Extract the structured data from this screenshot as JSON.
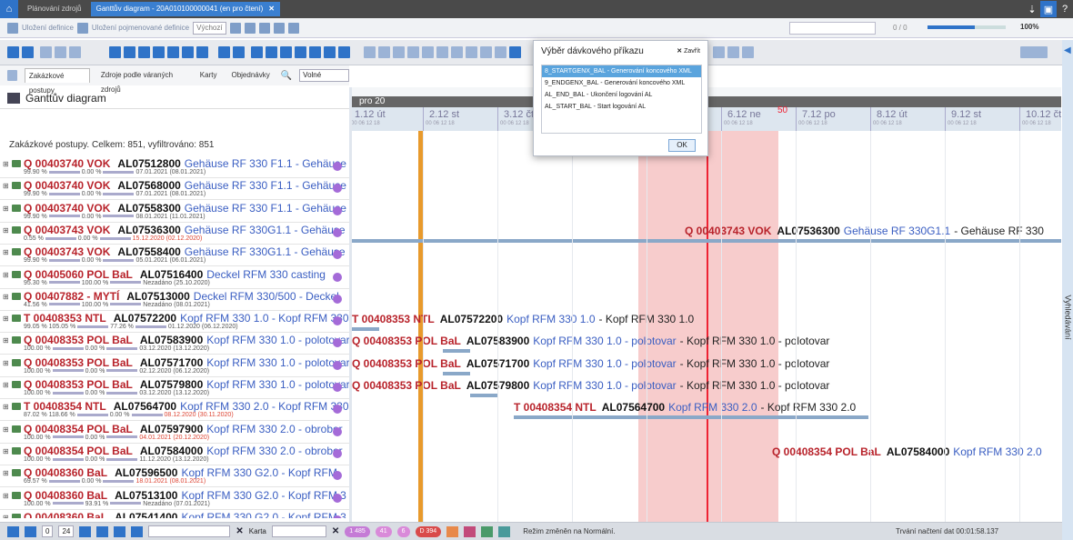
{
  "titlebar": {
    "tabs": [
      {
        "label": "Plánování zdrojů"
      },
      {
        "label": "Ganttův diagram - 20A010100000041 (en pro čtení)",
        "close": "✕"
      }
    ],
    "right_glyph_1": "⇣",
    "right_glyph_2": "?"
  },
  "toolbar2": {
    "save_label": "Uložení definice",
    "save_named_label": "Uložení pojmenované definice",
    "select_value": "Výchozí",
    "search_placeholder": "",
    "nav_text": "0 / 0",
    "zoom_label": "100%",
    "zoom_level": 0.6
  },
  "sidebar": {
    "tabs": [
      "Zakázkové postupy",
      "Zdroje podle váraných zdrojů",
      "Karty",
      "Objednávky"
    ],
    "filter_value": "Volné"
  },
  "gantt": {
    "title": "Ganttův diagram",
    "summary": "Zakázkové postupy. Celkem: 851, vyfiltrováno: 851",
    "week": "pro 20",
    "week_marker": "50",
    "days": [
      {
        "label": "1.12 út"
      },
      {
        "label": "2.12 st"
      },
      {
        "label": "3.12 čt"
      },
      {
        "label": "4.12 pá"
      },
      {
        "label": "5.12 so"
      },
      {
        "label": "6.12 ne"
      },
      {
        "label": "7.12 po"
      },
      {
        "label": "8.12 út"
      },
      {
        "label": "9.12 st"
      },
      {
        "label": "10.12 čt"
      }
    ],
    "hours": "00  06  12  18"
  },
  "rows": [
    {
      "code": "Q 00403740 VOK",
      "item": "AL07512800",
      "desc": "Gehäuse RF 330 F1.1 - Gehäuse",
      "pct1": "99.90 %",
      "pct2": "0.00 %",
      "dates": "07.01.2021 (08.01.2021)",
      "red": false
    },
    {
      "code": "Q 00403740 VOK",
      "item": "AL07568000",
      "desc": "Gehäuse RF 330 F1.1 - Gehäuse",
      "pct1": "99.90 %",
      "pct2": "0.00 %",
      "dates": "07.01.2021 (08.01.2021)",
      "red": false
    },
    {
      "code": "Q 00403740 VOK",
      "item": "AL07558300",
      "desc": "Gehäuse RF 330 F1.1 - Gehäuse",
      "pct1": "99.90 %",
      "pct2": "0.00 %",
      "dates": "08.01.2021 (11.01.2021)",
      "red": false
    },
    {
      "code": "Q 00403743 VOK",
      "item": "AL07536300",
      "desc": "Gehäuse RF 330G1.1 - Gehäuse",
      "pct1": "0.55 %",
      "pct2": "0.00 %",
      "dates": "15.12.2020 (02.12.2020)",
      "red": true
    },
    {
      "code": "Q 00403743 VOK",
      "item": "AL07558400",
      "desc": "Gehäuse RF 330G1.1 - Gehäuse",
      "pct1": "99.90 %",
      "pct2": "0.00 %",
      "dates": "05.01.2021 (06.01.2021)",
      "red": false
    },
    {
      "code": "Q 00405060 POL BaL",
      "item": "AL07516400",
      "desc": "Deckel RFM 330 casting",
      "pct1": "95.30 %",
      "pct2": "100.00 %",
      "dates": "Nezadáno (25.10.2020)",
      "red": false
    },
    {
      "code": "Q 00407882 - MYTÍ",
      "item": "AL07513000",
      "desc": "Deckel RFM 330/500 - Deckel",
      "pct1": "41.56 %",
      "pct2": "100.00 %",
      "dates": "Nezadáno (08.01.2021)",
      "red": false
    },
    {
      "code": "T 00408353 NTL",
      "item": "AL07572200",
      "desc": "Kopf RFM 330 1.0 - Kopf RFM 330",
      "pct1": "99.05 % 105.05 %",
      "pct2": "77.26 %",
      "dates": "01.12.2020 (06.12.2020)",
      "red": false
    },
    {
      "code": "Q 00408353 POL BaL",
      "item": "AL07583900",
      "desc": "Kopf RFM 330 1.0 - polotovar",
      "pct1": "100.00 %",
      "pct2": "0.00 %",
      "dates": "03.12.2020 (13.12.2020)",
      "red": false
    },
    {
      "code": "Q 00408353 POL BaL",
      "item": "AL07571700",
      "desc": "Kopf RFM 330 1.0 - polotovar",
      "pct1": "100.00 %",
      "pct2": "0.00 %",
      "dates": "02.12.2020 (06.12.2020)",
      "red": false
    },
    {
      "code": "Q 00408353 POL BaL",
      "item": "AL07579800",
      "desc": "Kopf RFM 330 1.0 - polotovar",
      "pct1": "100.00 %",
      "pct2": "0.00 %",
      "dates": "03.12.2020 (13.12.2020)",
      "red": false
    },
    {
      "code": "T 00408354 NTL",
      "item": "AL07564700",
      "desc": "Kopf RFM 330 2.0 - Kopf RFM 330",
      "pct1": "87.02 % 118.66 %",
      "pct2": "0.00 %",
      "dates": "08.12.2020 (30.11.2020)",
      "red": true
    },
    {
      "code": "Q 00408354 POL BaL",
      "item": "AL07597900",
      "desc": "Kopf RFM 330 2.0 - obrober",
      "pct1": "100.00 %",
      "pct2": "0.00 %",
      "dates": "04.01.2021 (20.12.2020)",
      "red": true
    },
    {
      "code": "Q 00408354 POL BaL",
      "item": "AL07584000",
      "desc": "Kopf RFM 330 2.0 - obrober",
      "pct1": "100.00 %",
      "pct2": "0.00 %",
      "dates": "11.12.2020 (13.12.2020)",
      "red": false
    },
    {
      "code": "Q 00408360 BaL",
      "item": "AL07596500",
      "desc": "Kopf RFM 330 G2.0 - Kopf RFM",
      "pct1": "69.57 %",
      "pct2": "0.00 %",
      "dates": "18.01.2021 (08.01.2021)",
      "red": true
    },
    {
      "code": "Q 00408360 BaL",
      "item": "AL07513100",
      "desc": "Kopf RFM 330 G2.0 - Kopf RFM 3",
      "pct1": "100.00 %",
      "pct2": "93.91 %",
      "dates": "Nezadáno (07.01.2021)",
      "red": false
    },
    {
      "code": "Q 00408360 BaL",
      "item": "AL07541400",
      "desc": "Kopf RFM 330 G2.0 - Kopf RFM 3",
      "pct1": "100.00 % 106.61 %",
      "pct2": "85.01 %",
      "dates": "17.12.2020 (24.11.2020)",
      "red": true
    }
  ],
  "gantt_tasks": [
    {
      "row": 3,
      "code": "Q 00403743 VOK",
      "item": "AL07536300",
      "desc": "Gehäuse RF 330G1.1",
      "rest": "- Gehäuse RF 330"
    },
    {
      "row": 7,
      "code": "T 00408353 NTL",
      "item": "AL07572200",
      "desc": "Kopf RFM 330 1.0",
      "rest": "- Kopf RFM 330 1.0"
    },
    {
      "row": 8,
      "code": "Q 00408353 POL BaL",
      "item": "AL07583900",
      "desc": "Kopf RFM 330 1.0 - polotovar",
      "rest": "- Kopf RFM 330 1.0 - polotovar"
    },
    {
      "row": 9,
      "code": "Q 00408353 POL BaL",
      "item": "AL07571700",
      "desc": "Kopf RFM 330 1.0 - polotovar",
      "rest": "- Kopf RFM 330 1.0 - polotovar"
    },
    {
      "row": 10,
      "code": "Q 00408353 POL BaL",
      "item": "AL07579800",
      "desc": "Kopf RFM 330 1.0 - polotovar",
      "rest": "- Kopf RFM 330 1.0 - polotovar"
    },
    {
      "row": 11,
      "code": "T 00408354 NTL",
      "item": "AL07564700",
      "desc": "Kopf RFM 330 2.0",
      "rest": "- Kopf RFM 330 2.0"
    },
    {
      "row": 13,
      "code": "Q 00408354 POL BaL",
      "item": "AL07584000",
      "desc": "Kopf RFM 330 2.0",
      "rest": ""
    }
  ],
  "dialog": {
    "title": "Výběr dávkového příkazu",
    "close": "Zavřít",
    "items": [
      "8_STARTGENX_BAL - Generování koncového XML",
      "9_ENDGENX_BAL - Generování koncového XML",
      "AL_END_BAL - Ukončení logování AL",
      "AL_START_BAL - Start logování AL"
    ],
    "ok": "OK"
  },
  "statusbar": {
    "value1": "0",
    "value2": "24",
    "karta_label": "Karta",
    "pill1": "1 485",
    "pill2": "41",
    "pill3": "6",
    "pill4": "D 394",
    "message": "Režim změněn na Normální.",
    "time": "Trvání načtení dat 00:01:58.137"
  },
  "right_panel": {
    "label": "Vyhledávání"
  },
  "colors": {
    "accent": "#2f73c8",
    "red": "#b8232b",
    "blue_text": "#3a5ec2",
    "orange": "#e89a2c",
    "pink_zone": "#f7cccc"
  }
}
